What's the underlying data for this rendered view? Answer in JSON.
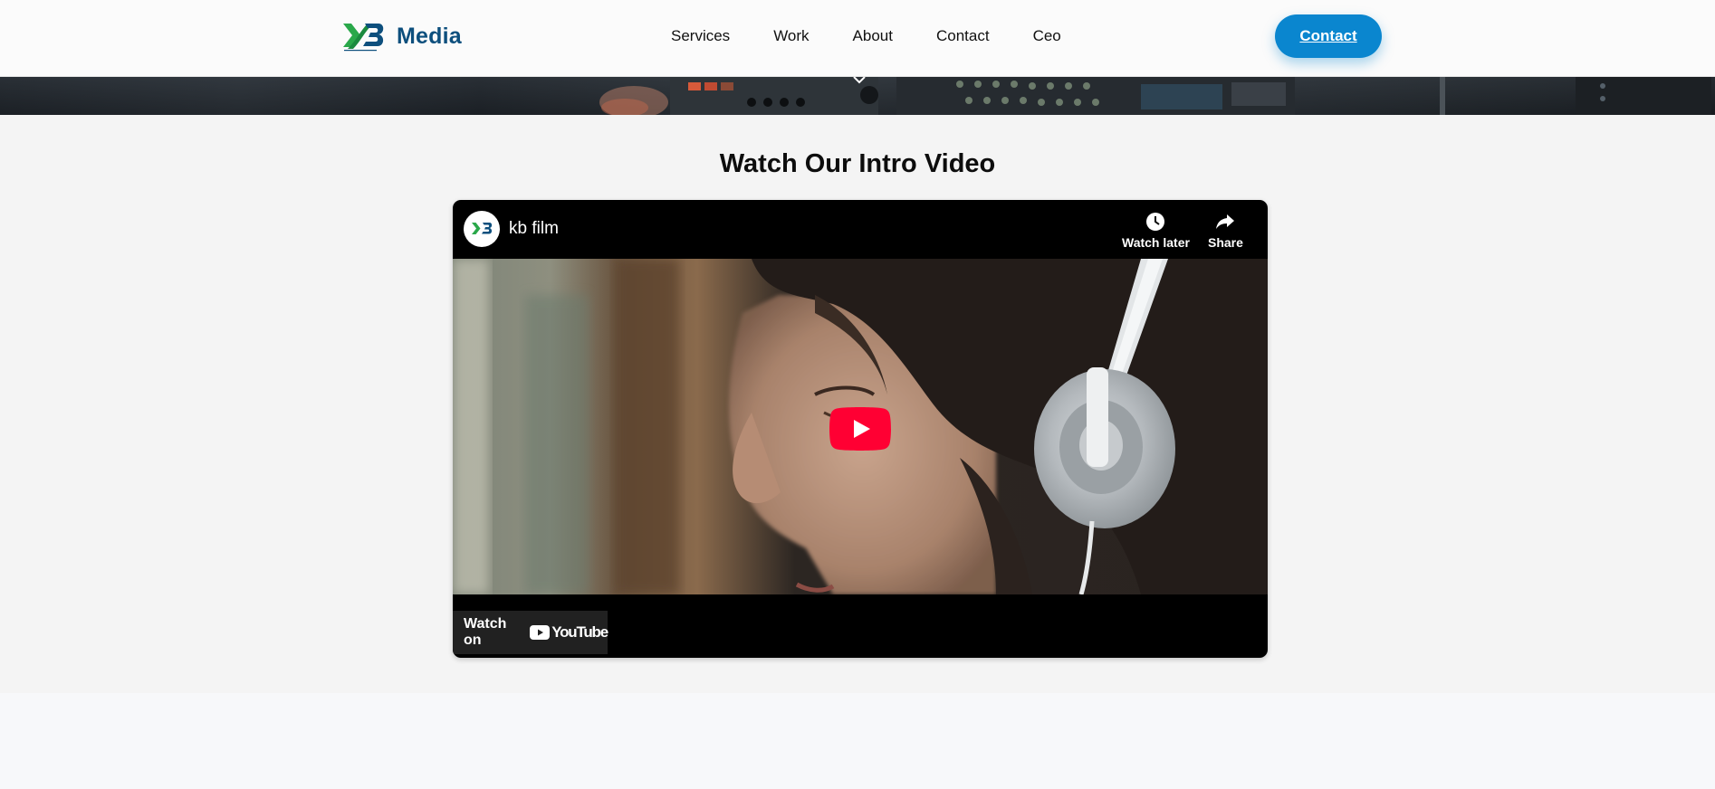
{
  "header": {
    "logo_text": "Media",
    "logo_mark": "kb-logo-icon",
    "nav_items": [
      "Services",
      "Work",
      "About",
      "Contact",
      "Ceo"
    ],
    "cta_label": "Contact",
    "accent_color": "#0a86cf",
    "brand_color": "#0d4f7d"
  },
  "hero": {
    "indicator_icon": "chevron-down-icon"
  },
  "video_section": {
    "title": "Watch Our Intro Video",
    "player": {
      "channel_name": "kb film",
      "channel_avatar": "kb-logo-icon",
      "watch_later_label": "Watch later",
      "watch_later_icon": "clock-icon",
      "share_label": "Share",
      "share_icon": "share-arrow-icon",
      "play_icon": "youtube-play-icon",
      "play_color": "#ff0033",
      "watch_on_label": "Watch on",
      "youtube_label": "YouTube"
    }
  }
}
